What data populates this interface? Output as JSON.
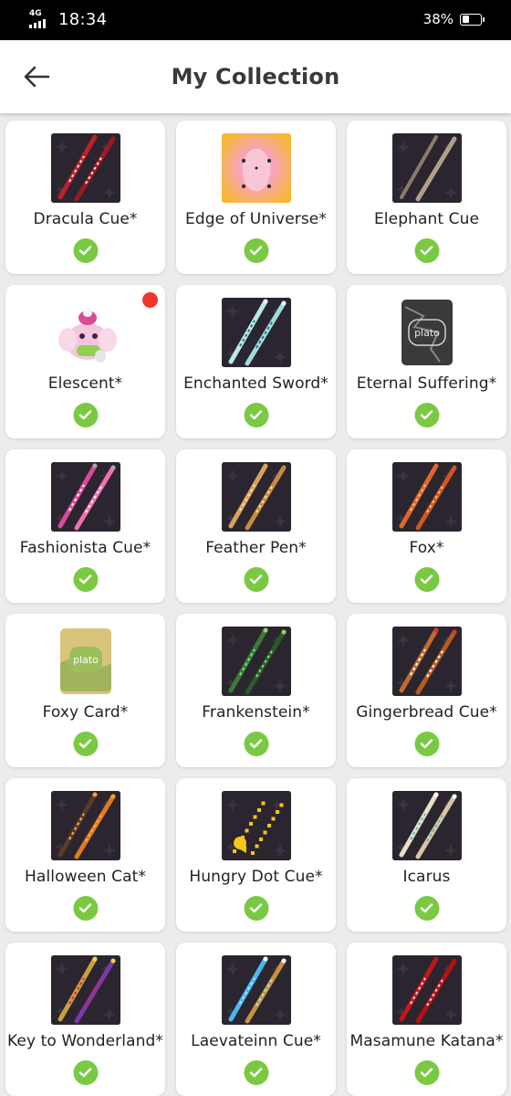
{
  "status": {
    "network": "4G",
    "time": "18:34",
    "battery": "38%",
    "battery_level": 0.38
  },
  "header": {
    "title": "My Collection",
    "back_icon": "arrow-left-icon"
  },
  "colors": {
    "check": "#7ac943",
    "new_badge": "#f2352b",
    "card": "#ffffff",
    "background": "#ececec"
  },
  "items": [
    {
      "name": "Dracula Cue*",
      "owned": true,
      "thumbnail": "dracula-cue-thumbnail"
    },
    {
      "name": "Edge of Universe*",
      "owned": true,
      "thumbnail": "edge-of-universe-thumbnail"
    },
    {
      "name": "Elephant Cue",
      "owned": true,
      "thumbnail": "elephant-cue-thumbnail"
    },
    {
      "name": "Elescent*",
      "owned": true,
      "new": true,
      "thumbnail": "elescent-thumbnail"
    },
    {
      "name": "Enchanted Sword*",
      "owned": true,
      "thumbnail": "enchanted-sword-thumbnail"
    },
    {
      "name": "Eternal Suffering*",
      "owned": true,
      "thumbnail": "eternal-suffering-card-thumbnail",
      "card_text": "plato"
    },
    {
      "name": "Fashionista Cue*",
      "owned": true,
      "thumbnail": "fashionista-cue-thumbnail"
    },
    {
      "name": "Feather Pen*",
      "owned": true,
      "thumbnail": "feather-pen-thumbnail"
    },
    {
      "name": "Fox*",
      "owned": true,
      "thumbnail": "fox-cue-thumbnail"
    },
    {
      "name": "Foxy Card*",
      "owned": true,
      "thumbnail": "foxy-card-thumbnail",
      "card_text": "plato"
    },
    {
      "name": "Frankenstein*",
      "owned": true,
      "thumbnail": "frankenstein-cue-thumbnail"
    },
    {
      "name": "Gingerbread Cue*",
      "owned": true,
      "thumbnail": "gingerbread-cue-thumbnail"
    },
    {
      "name": "Halloween Cat*",
      "owned": true,
      "thumbnail": "halloween-cat-thumbnail"
    },
    {
      "name": "Hungry Dot Cue*",
      "owned": true,
      "thumbnail": "hungry-dot-cue-thumbnail"
    },
    {
      "name": "Icarus",
      "owned": true,
      "thumbnail": "icarus-cue-thumbnail"
    },
    {
      "name": "Key to Wonderland*",
      "owned": true,
      "thumbnail": "key-to-wonderland-thumbnail"
    },
    {
      "name": "Laevateinn Cue*",
      "owned": true,
      "thumbnail": "laevateinn-cue-thumbnail"
    },
    {
      "name": "Masamune Katana*",
      "owned": true,
      "thumbnail": "masamune-katana-thumbnail"
    }
  ]
}
